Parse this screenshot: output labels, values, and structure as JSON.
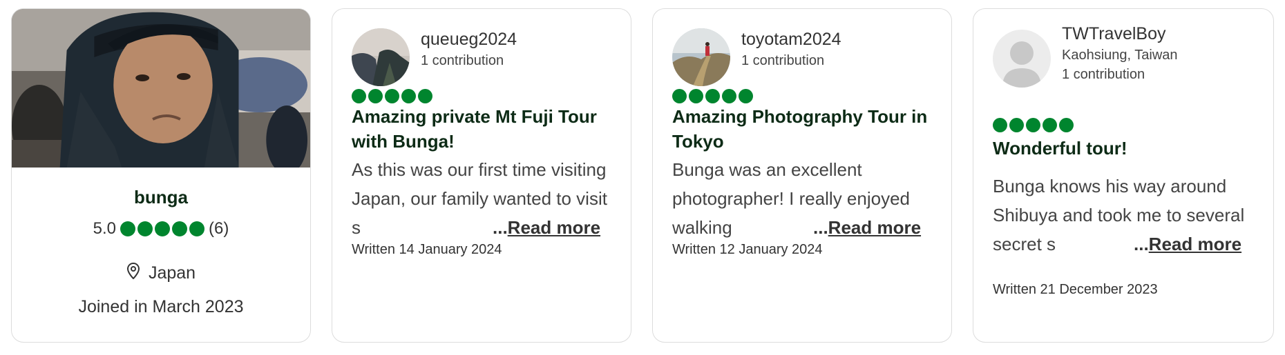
{
  "profile": {
    "name": "bunga",
    "rating": "5.0",
    "review_count": "(6)",
    "bubbles": 5,
    "location": "Japan",
    "joined": "Joined in March 2023"
  },
  "reviews": [
    {
      "username": "queueg2024",
      "hometown": "",
      "contributions": "1 contribution",
      "bubbles": 5,
      "title": "Amazing private Mt Fuji Tour with Bunga!",
      "body": "As this was our first time visiting Japan, our family wanted to visit s",
      "read_more_dots": "...",
      "read_more": "Read more",
      "written": "Written 14 January 2024"
    },
    {
      "username": "toyotam2024",
      "hometown": "",
      "contributions": "1 contribution",
      "bubbles": 5,
      "title": "Amazing Photography Tour in Tokyo",
      "body": "Bunga was an excellent photographer! I really enjoyed walking",
      "read_more_dots": "...",
      "read_more": "Read more",
      "written": "Written 12 January 2024"
    },
    {
      "username": "TWTravelBoy",
      "hometown": "Kaohsiung, Taiwan",
      "contributions": "1 contribution",
      "bubbles": 5,
      "title": "Wonderful tour!",
      "body": "Bunga knows his way around Shibuya and took me to several secret s",
      "read_more_dots": "...",
      "read_more": "Read more",
      "written": "Written 21 December 2023"
    }
  ],
  "colors": {
    "bubble": "#00852e",
    "title": "#0d2b16",
    "border": "#dcdcdc"
  }
}
